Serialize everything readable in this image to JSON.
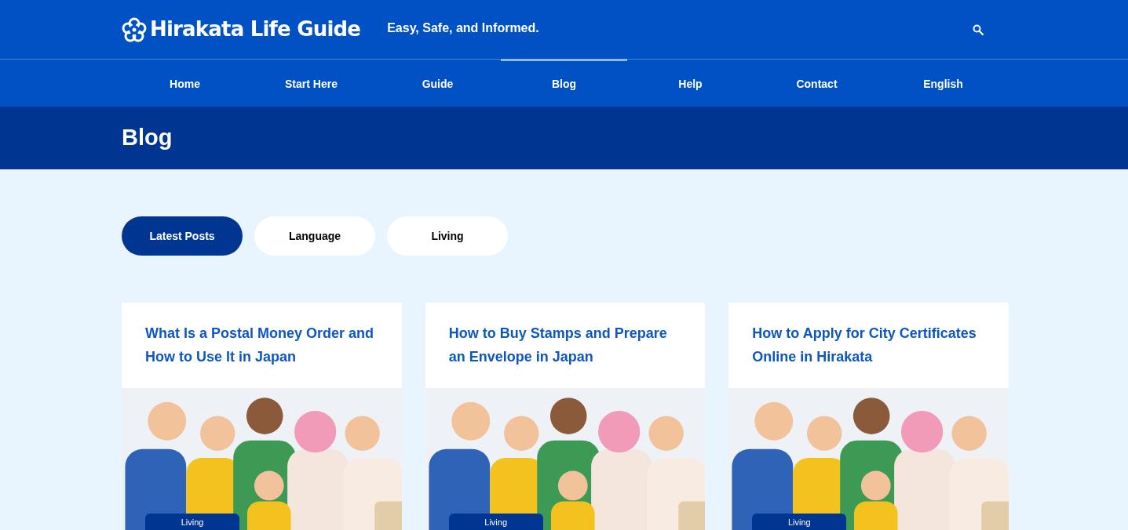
{
  "header": {
    "logo": "Hirakata Life Guide",
    "tagline": "Easy, Safe, and Informed."
  },
  "nav": [
    {
      "label": "Home",
      "selected": false
    },
    {
      "label": "Start Here",
      "selected": false
    },
    {
      "label": "Guide",
      "selected": false
    },
    {
      "label": "Blog",
      "selected": true
    },
    {
      "label": "Help",
      "selected": false
    },
    {
      "label": "Contact",
      "selected": false
    },
    {
      "label": "English",
      "selected": false
    }
  ],
  "page_title": "Blog",
  "filters": [
    {
      "label": "Latest Posts",
      "selected": true
    },
    {
      "label": "Language",
      "selected": false
    },
    {
      "label": "Living",
      "selected": false
    }
  ],
  "posts": [
    {
      "title": "What Is a Postal Money Order and How to Use It in Japan",
      "category": "Living"
    },
    {
      "title": "How to Buy Stamps and Prepare an Envelope in Japan",
      "category": "Living"
    },
    {
      "title": "How to Apply for City Certificates Online in Hirakata",
      "category": "Living"
    }
  ]
}
